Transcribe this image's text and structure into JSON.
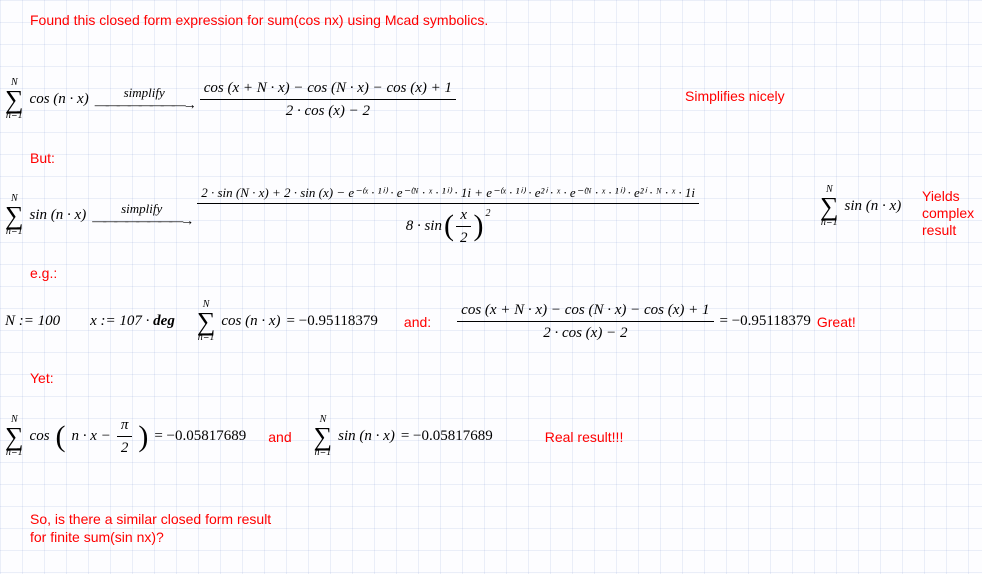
{
  "title": "Found this closed form expression for sum(cos nx) using Mcad symbolics.",
  "note_simplifies": "Simplifies nicely",
  "but_label": "But:",
  "yields_label": "Yields complex result",
  "eg_label": "e.g.:",
  "N_assign": "N := 100",
  "x_assign_prefix": "x := 107 ·",
  "x_assign_unit": "deg",
  "and_label": "and:",
  "great_label": "Great!",
  "yet_label": "Yet:",
  "and2_label": "and",
  "real_label": "Real result!!!",
  "closing_q": "So, is there a similar closed form result for finite sum(sin nx)?",
  "simplify_kw": "simplify",
  "cos_simplified_num": "cos (x + N · x) − cos (N · x) − cos (x) + 1",
  "cos_simplified_den": "2 · cos (x) − 2",
  "sin_simplified_num": "2 · sin (N · x) + 2 · sin (x) − e⁻⁽ˣ · ¹ⁱ⁾ · e⁻⁽ᴺ · ˣ · ¹ⁱ⁾ · 1i + e⁻⁽ˣ · ¹ⁱ⁾ · e²ⁱ · ˣ · e⁻⁽ᴺ · ˣ · ¹ⁱ⁾ · e²ⁱ · ᴺ · ˣ · 1i",
  "sin_simplified_den_prefix": "8 · sin",
  "sin_frac_top": "x",
  "sin_frac_bot": "2",
  "sin_sq": "2",
  "sum_top": "N",
  "sum_bot": "n=1",
  "sum_cos_body": "cos (n · x)",
  "sum_sin_body": "sin (n · x)",
  "sum_cos_shifted": "cos",
  "shifted_arg_a": "n · x −",
  "shifted_arg_pi": "π",
  "shifted_arg_2": "2",
  "val_cos_sum": "= −0.95118379",
  "val_closed_cos": "= −0.95118379",
  "val_shifted": "= −0.05817689",
  "val_sin_sum": "= −0.05817689"
}
